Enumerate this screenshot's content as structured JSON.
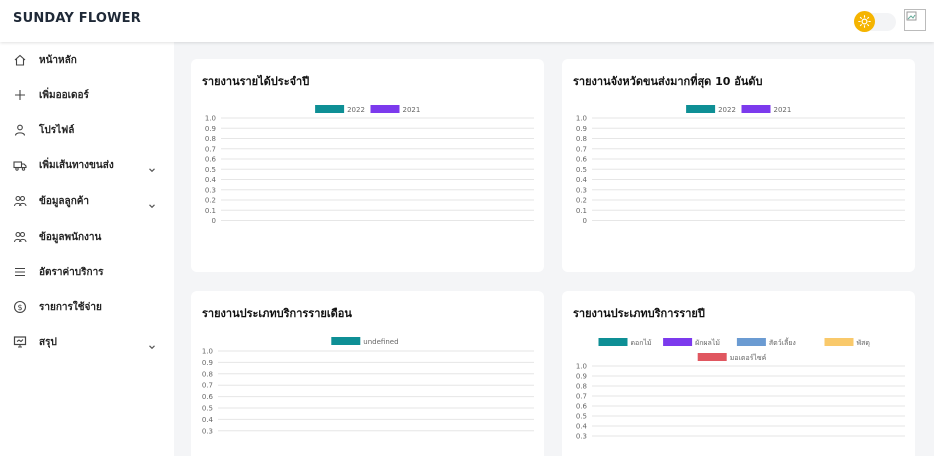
{
  "app": {
    "brand": "SUNDAY FLOWER"
  },
  "header": {
    "theme_toggle_icon": "sun-icon",
    "avatar_alt": ""
  },
  "sidebar": {
    "items": [
      {
        "label": "หน้าหลัก",
        "icon": "home-icon",
        "has_chevron": false
      },
      {
        "label": "เพิ่มออเดอร์",
        "icon": "plus-icon",
        "has_chevron": false
      },
      {
        "label": "โปรไฟล์",
        "icon": "user-icon",
        "has_chevron": false
      },
      {
        "label": "เพิ่มเส้นทางขนส่ง",
        "icon": "truck-icon",
        "has_chevron": true
      },
      {
        "label": "ข้อมูลลูกค้า",
        "icon": "users-icon",
        "has_chevron": true
      },
      {
        "label": "ข้อมูลพนักงาน",
        "icon": "users-icon",
        "has_chevron": false
      },
      {
        "label": "อัตราค่าบริการ",
        "icon": "list-icon",
        "has_chevron": false
      },
      {
        "label": "รายการใช้จ่าย",
        "icon": "dollar-icon",
        "has_chevron": false
      },
      {
        "label": "สรุป",
        "icon": "monitor-icon",
        "has_chevron": true
      }
    ]
  },
  "cards": [
    {
      "title": "รายงานรายได้ประจำปี"
    },
    {
      "title": "รายงานจังหวัดขนส่งมากที่สุด 10 อันดับ"
    },
    {
      "title": "รายงานประเภทบริการรายเดือน"
    },
    {
      "title": "รายงานประเภทบริการรายปี"
    }
  ],
  "chart_data": [
    {
      "type": "bar",
      "series": [
        {
          "name": "2022",
          "color": "#0e8f95",
          "values": []
        },
        {
          "name": "2021",
          "color": "#7c3aed",
          "values": []
        }
      ],
      "y_ticks": [
        "1.0",
        "0.9",
        "0.8",
        "0.7",
        "0.6",
        "0.5",
        "0.4",
        "0.3",
        "0.2",
        "0.1",
        "0"
      ],
      "ylim": [
        0,
        1
      ]
    },
    {
      "type": "bar",
      "series": [
        {
          "name": "2022",
          "color": "#0e8f95",
          "values": []
        },
        {
          "name": "2021",
          "color": "#7c3aed",
          "values": []
        }
      ],
      "y_ticks": [
        "1.0",
        "0.9",
        "0.8",
        "0.7",
        "0.6",
        "0.5",
        "0.4",
        "0.3",
        "0.2",
        "0.1",
        "0"
      ],
      "ylim": [
        0,
        1
      ]
    },
    {
      "type": "bar",
      "series": [
        {
          "name": "undefined",
          "color": "#0e8f95",
          "values": []
        }
      ],
      "y_ticks": [
        "1.0",
        "0.9",
        "0.8",
        "0.7",
        "0.6",
        "0.5",
        "0.4",
        "0.3"
      ],
      "ylim": [
        0,
        1
      ]
    },
    {
      "type": "bar",
      "series": [
        {
          "name": "ดอกไม้",
          "color": "#0e8f95",
          "values": []
        },
        {
          "name": "ผักผลไม้",
          "color": "#7c3aed",
          "values": []
        },
        {
          "name": "สัตว์เลี้ยง",
          "color": "#6b9bd2",
          "values": []
        },
        {
          "name": "พัสดุ",
          "color": "#f9c96b",
          "values": []
        },
        {
          "name": "มอเตอร์ไซค์",
          "color": "#e05760",
          "values": []
        }
      ],
      "y_ticks": [
        "1.0",
        "0.9",
        "0.8",
        "0.7",
        "0.6",
        "0.5",
        "0.4",
        "0.3"
      ],
      "ylim": [
        0,
        1
      ]
    }
  ]
}
